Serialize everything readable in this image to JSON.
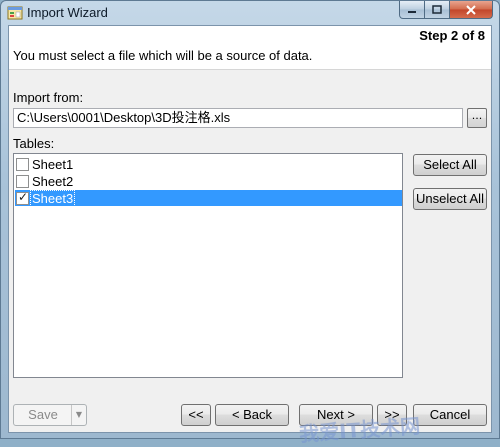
{
  "window": {
    "title": "Import Wizard",
    "icon": "wizard-app-icon"
  },
  "header": {
    "step": "Step 2 of 8",
    "instruction": "You must select a file which will be a source of data."
  },
  "import_from": {
    "label": "Import from:",
    "value": "C:\\Users\\0001\\Desktop\\3D投注格.xls",
    "browse_label": "..."
  },
  "tables": {
    "label": "Tables:",
    "items": [
      {
        "label": "Sheet1",
        "checked": false,
        "selected": false
      },
      {
        "label": "Sheet2",
        "checked": false,
        "selected": false
      },
      {
        "label": "Sheet3",
        "checked": true,
        "selected": true
      }
    ]
  },
  "side_buttons": {
    "select_all": "Select All",
    "unselect_all": "Unselect All"
  },
  "footer": {
    "save": "Save",
    "first": "<<",
    "back": "< Back",
    "next": "Next >",
    "last": ">>",
    "cancel": "Cancel"
  },
  "watermark": {
    "text": "我爱IT技术网"
  },
  "colors": {
    "selection": "#3399ff",
    "titlebar": "#b9cfe2",
    "close_button": "#c2452a"
  }
}
